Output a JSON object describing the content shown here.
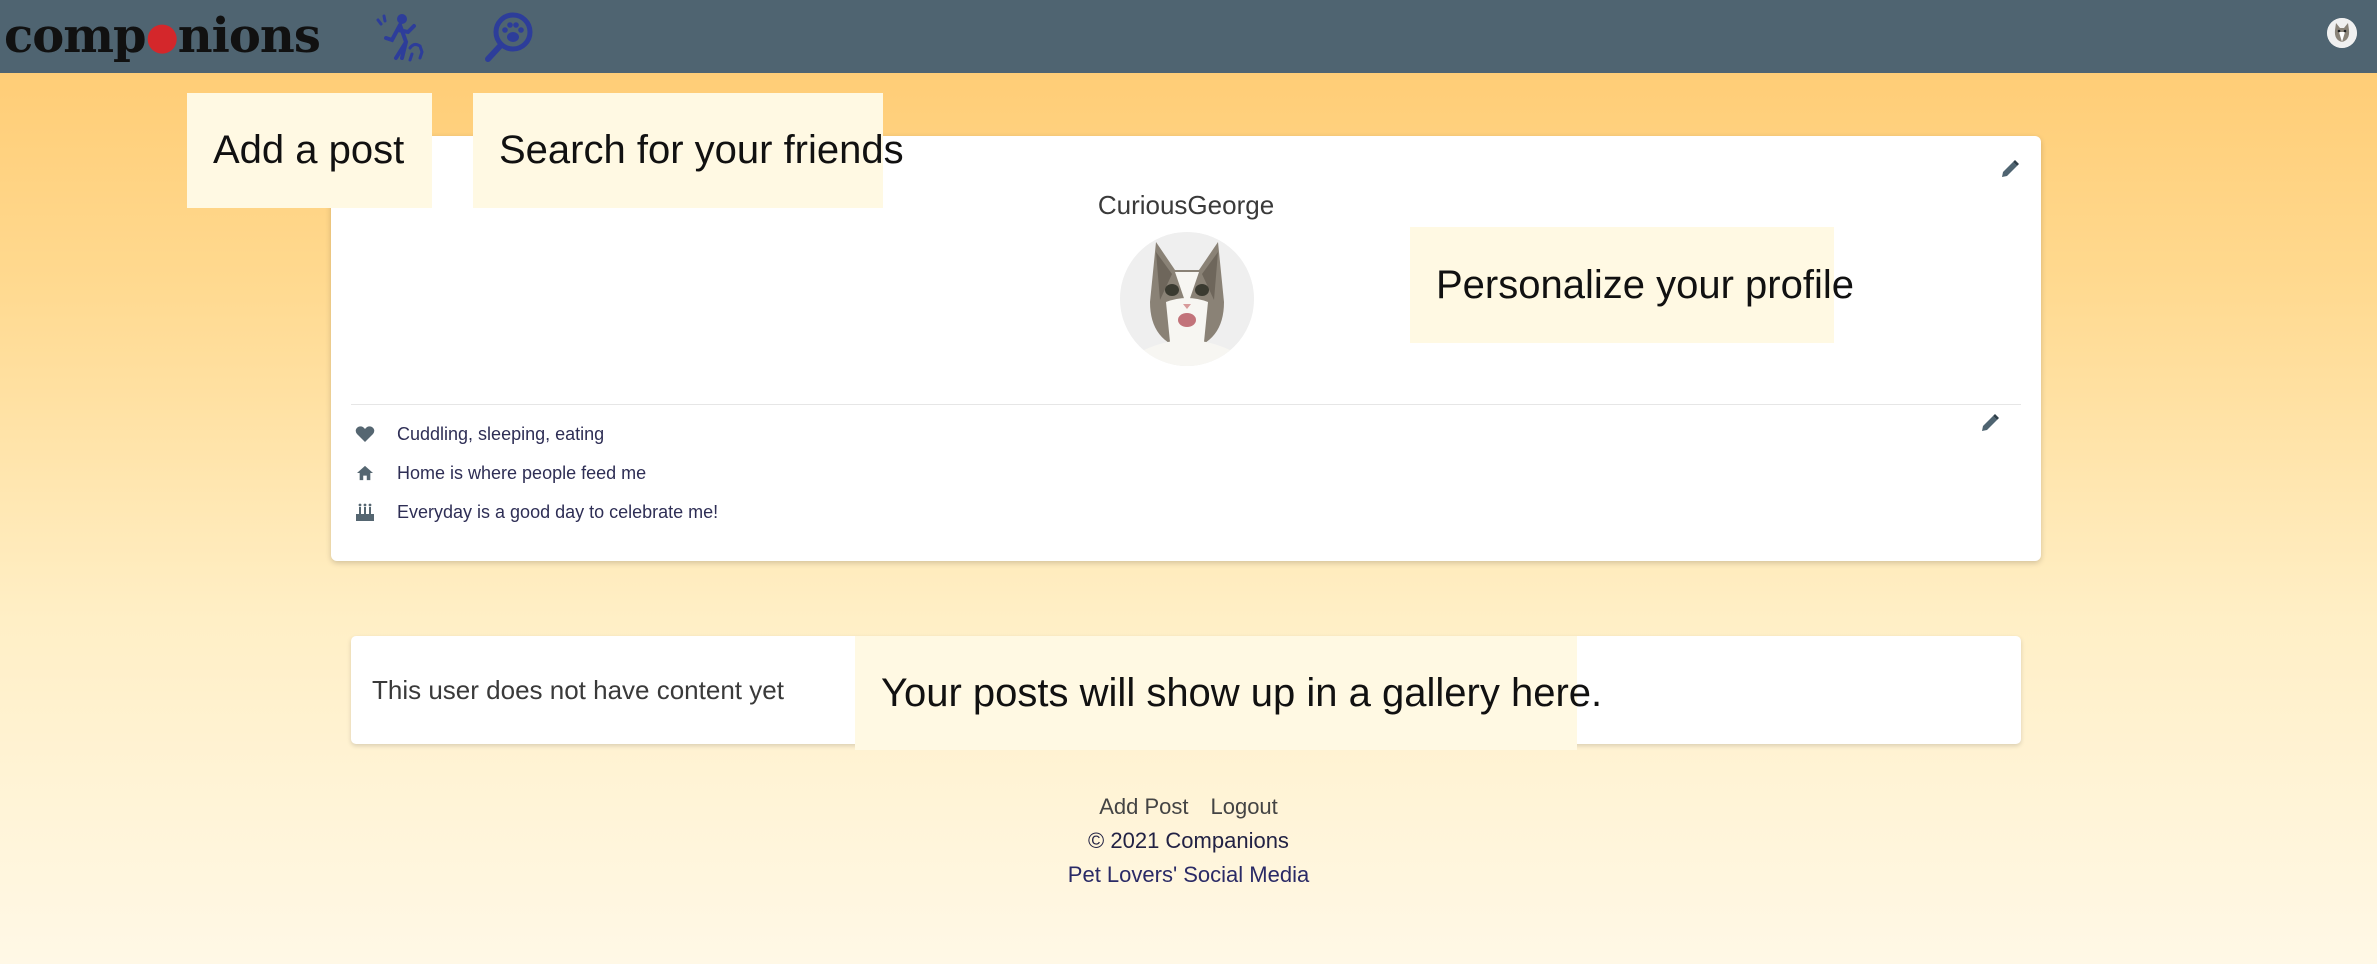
{
  "brand": {
    "prefix": "comp",
    "suffix": "nions",
    "paw_icon": "paw-icon"
  },
  "nav": {
    "add_post_icon": "person-with-pet-icon",
    "search_icon": "paw-search-icon",
    "user_avatar_icon": "cat-avatar-icon"
  },
  "callouts": {
    "add_post": "Add a post",
    "search": "Search for your friends",
    "personalize": "Personalize your profile",
    "gallery": "Your posts will show up in a gallery here."
  },
  "profile": {
    "username": "CuriousGeorge",
    "hobbies": "Cuddling, sleeping, eating",
    "home": "Home is where people feed me",
    "birthday": "Everyday is a good day to celebrate me!"
  },
  "content": {
    "empty_message": "This user does not have content yet"
  },
  "footer": {
    "add_post": "Add Post",
    "logout": "Logout",
    "copyright": "© 2021 Companions",
    "tagline": "Pet Lovers' Social Media"
  },
  "colors": {
    "navbar": "#4f6471",
    "accent_icon": "#2d3d9a",
    "paw": "#d4272b",
    "callout_bg": "#fff9e3"
  }
}
